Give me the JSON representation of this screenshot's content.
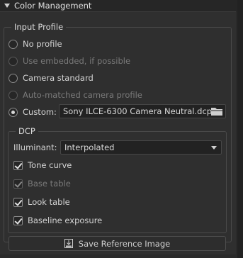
{
  "header": {
    "title": "Color Management"
  },
  "input_profile": {
    "title": "Input Profile",
    "options": [
      {
        "label": "No profile",
        "checked": false,
        "disabled": false
      },
      {
        "label": "Use embedded, if possible",
        "checked": false,
        "disabled": true
      },
      {
        "label": "Camera standard",
        "checked": false,
        "disabled": false
      },
      {
        "label": "Auto-matched camera profile",
        "checked": false,
        "disabled": true
      },
      {
        "label": "Custom:",
        "checked": true,
        "disabled": false
      }
    ],
    "custom_file": "Sony ILCE-6300 Camera Neutral.dcp"
  },
  "dcp": {
    "title": "DCP",
    "illuminant_label": "Illuminant:",
    "illuminant_value": "Interpolated",
    "checks": [
      {
        "label": "Tone curve",
        "checked": true,
        "disabled": false
      },
      {
        "label": "Base table",
        "checked": true,
        "disabled": true
      },
      {
        "label": "Look table",
        "checked": true,
        "disabled": false
      },
      {
        "label": "Baseline exposure",
        "checked": true,
        "disabled": false
      }
    ]
  },
  "save_button": {
    "label": "Save Reference Image"
  }
}
